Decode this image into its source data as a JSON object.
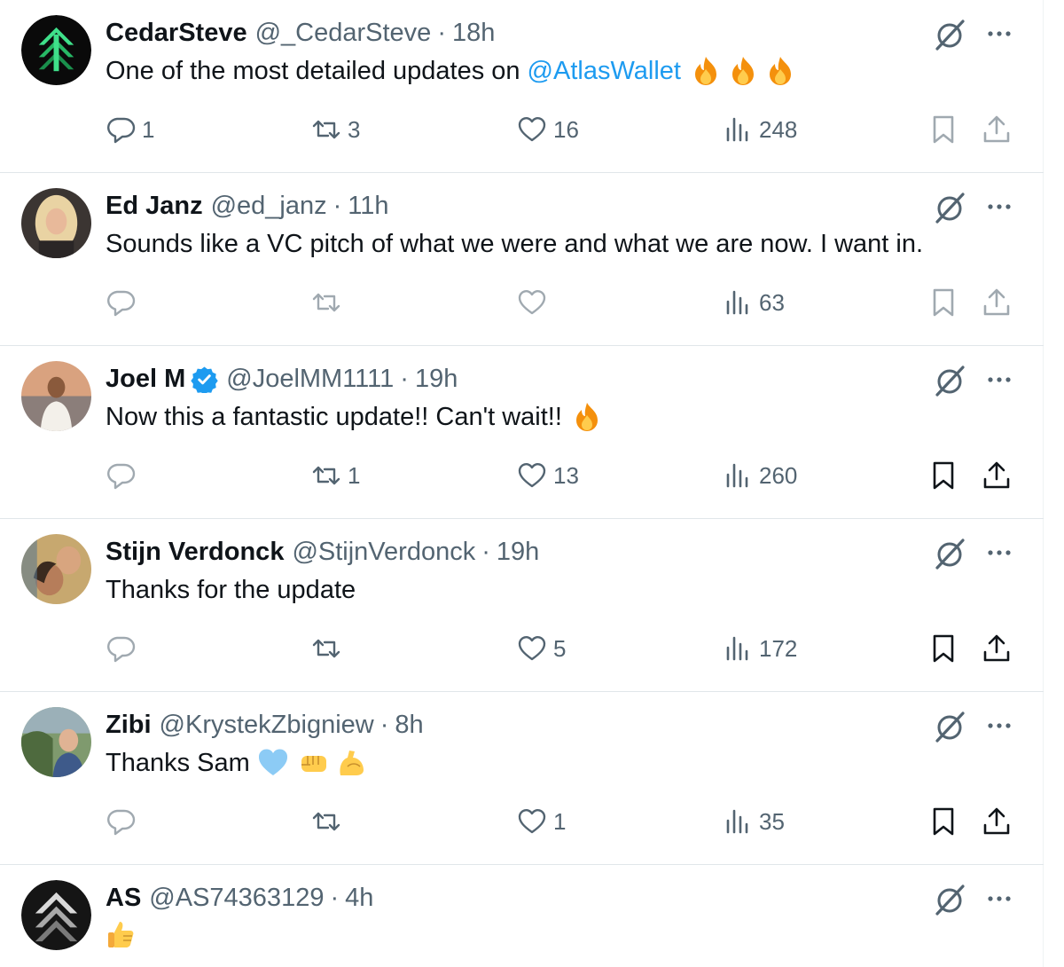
{
  "tweets": [
    {
      "name": "CedarSteve",
      "handle": "@_CedarSteve",
      "sep": "·",
      "time": "18h",
      "text": "One of the most detailed updates on",
      "mention": "@AtlasWallet",
      "emojis": [
        "fire-emoji",
        "fire-emoji",
        "fire-emoji"
      ],
      "verified": false,
      "avatar": "green-chevron-logo",
      "replies": "1",
      "retweets": "3",
      "likes": "16",
      "views": "248"
    },
    {
      "name": "Ed Janz",
      "handle": "@ed_janz",
      "sep": "·",
      "time": "11h",
      "text": "Sounds like a VC pitch of what we were and what we are now. I want in.",
      "mention": "",
      "emojis": [],
      "verified": false,
      "avatar": "portrait-blonde",
      "replies": "",
      "retweets": "",
      "likes": "",
      "views": "63"
    },
    {
      "name": "Joel M",
      "handle": "@JoelMM1111",
      "sep": "·",
      "time": "19h",
      "text": "Now this a fantastic update!! Can't wait!!",
      "mention": "",
      "emojis": [
        "fire-emoji"
      ],
      "verified": true,
      "avatar": "portrait-beach",
      "replies": "",
      "retweets": "1",
      "likes": "13",
      "views": "260"
    },
    {
      "name": "Stijn Verdonck",
      "handle": "@StijnVerdonck",
      "sep": "·",
      "time": "19h",
      "text": "Thanks for the update",
      "mention": "",
      "emojis": [],
      "verified": false,
      "avatar": "portrait-couple",
      "replies": "",
      "retweets": "",
      "likes": "5",
      "views": "172"
    },
    {
      "name": "Zibi",
      "handle": "@KrystekZbigniew",
      "sep": "·",
      "time": "8h",
      "text": "Thanks Sam",
      "mention": "",
      "emojis": [
        "light-blue-heart-emoji",
        "fist-emoji",
        "flexed-biceps-emoji"
      ],
      "verified": false,
      "avatar": "portrait-outdoor",
      "replies": "",
      "retweets": "",
      "likes": "1",
      "views": "35"
    },
    {
      "name": "AS",
      "handle": "@AS74363129",
      "sep": "·",
      "time": "4h",
      "text": "",
      "mention": "",
      "emojis": [
        "thumbs-up-emoji"
      ],
      "verified": false,
      "avatar": "grey-chevron-logo"
    }
  ],
  "colors": {
    "text": "#0f1419",
    "secondary": "#536471",
    "link": "#1d9bf0",
    "divider": "#e1e6ea",
    "verified": "#1d9bf0"
  }
}
